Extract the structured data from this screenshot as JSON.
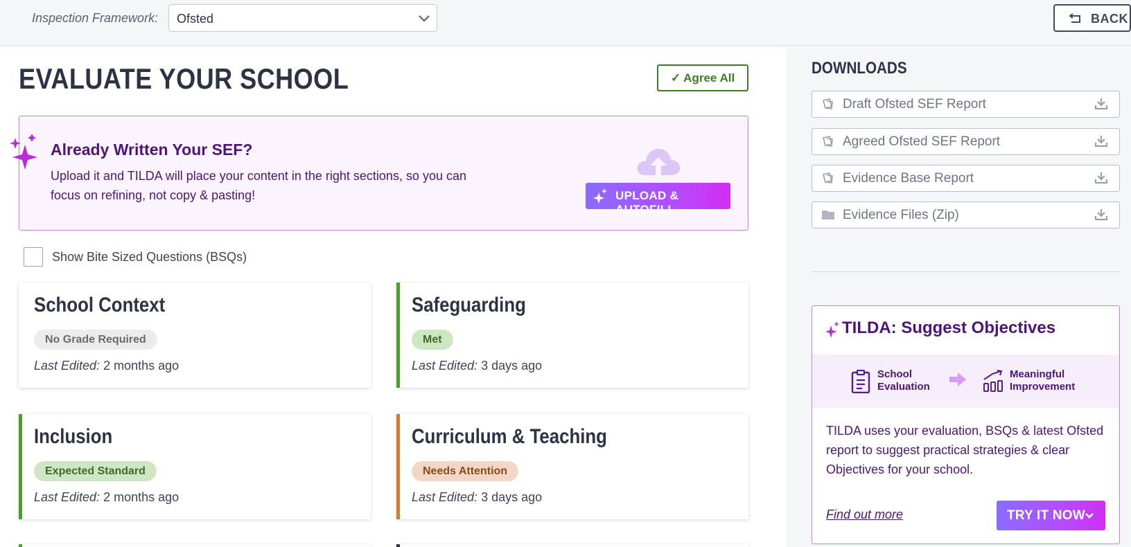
{
  "header": {
    "framework_label": "Inspection Framework:",
    "framework_value": "Ofsted",
    "back_label": "BACK"
  },
  "main": {
    "title": "EVALUATE YOUR SCHOOL",
    "agree_all_label": "✓ Agree All",
    "sef_promo": {
      "title": "Already Written Your SEF?",
      "description": "Upload it and TILDA will place your content in the right sections, so you can focus on refining, not copy & pasting!",
      "button_label": "UPLOAD & AUTOFILL"
    },
    "bsq_label": "Show Bite Sized Questions (BSQs)",
    "bsq_checked": false,
    "last_edited_label": "Last Edited:",
    "cards": [
      {
        "title": "School Context",
        "badge": "No Grade Required",
        "edited": "2 months ago",
        "accent": "#ffffff",
        "badge_bg": "#ececec",
        "badge_fg": "#6b6b6b"
      },
      {
        "title": "Safeguarding",
        "badge": "Met",
        "edited": "3 days ago",
        "accent": "#4a9e2c",
        "badge_bg": "#cfe6c4",
        "badge_fg": "#3e6a2a"
      },
      {
        "title": "Inclusion",
        "badge": "Expected Standard",
        "edited": "2 months ago",
        "accent": "#4a9e2c",
        "badge_bg": "#cfe6c4",
        "badge_fg": "#3e6a2a"
      },
      {
        "title": "Curriculum & Teaching",
        "badge": "Needs Attention",
        "edited": "3 days ago",
        "accent": "#d17a33",
        "badge_bg": "#f3d7c6",
        "badge_fg": "#8a4a1d"
      }
    ]
  },
  "downloads": {
    "title": "DOWNLOADS",
    "items": [
      {
        "label": "Draft Ofsted SEF Report",
        "icon": "document-icon"
      },
      {
        "label": "Agreed Ofsted SEF Report",
        "icon": "document-icon"
      },
      {
        "label": "Evidence Base Report",
        "icon": "document-icon"
      },
      {
        "label": "Evidence Files (Zip)",
        "icon": "folder-icon"
      }
    ]
  },
  "tilda": {
    "title": "TILDA: Suggest Objectives",
    "flow_from": "School Evaluation",
    "flow_from_l1": "School",
    "flow_from_l2": "Evaluation",
    "flow_to": "Meaningful Improvement",
    "flow_to_l1": "Meaningful",
    "flow_to_l2": "Improvement",
    "description": "TILDA uses your evaluation, BSQs & latest Ofsted report to suggest practical strategies & clear Objectives for your school.",
    "find_more_label": "Find out more",
    "try_label": "TRY IT NOW"
  },
  "colors": {
    "brand_purple": "#4e1577",
    "accent_green": "#4a9e2c",
    "accent_orange": "#d17a33"
  }
}
